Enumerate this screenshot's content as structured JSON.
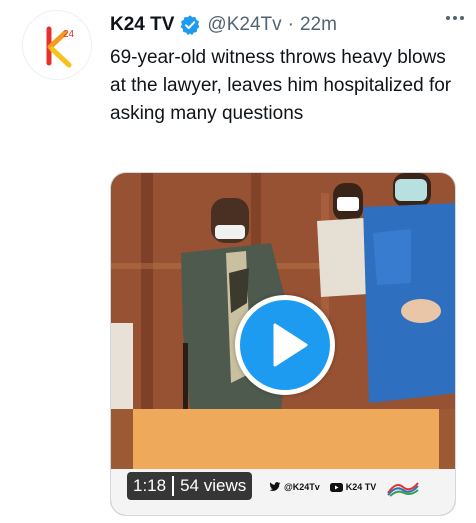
{
  "tweet": {
    "author_name": "K24 TV",
    "handle": "@K24Tv",
    "separator": "·",
    "time": "22m",
    "text": "69-year-old witness throws heavy blows at the lawyer, leaves him hospitalized for asking many questions",
    "avatar_logo": "k24-logo",
    "verified": true,
    "accent_color": "#1d9bf0"
  },
  "media": {
    "type": "video",
    "duration": "1:18",
    "views": "54 views",
    "watermark": {
      "twitter": "@K24Tv",
      "youtube": "K24 TV"
    },
    "icons": [
      "play-icon",
      "twitter-icon",
      "youtube-icon",
      "station-logo"
    ]
  }
}
